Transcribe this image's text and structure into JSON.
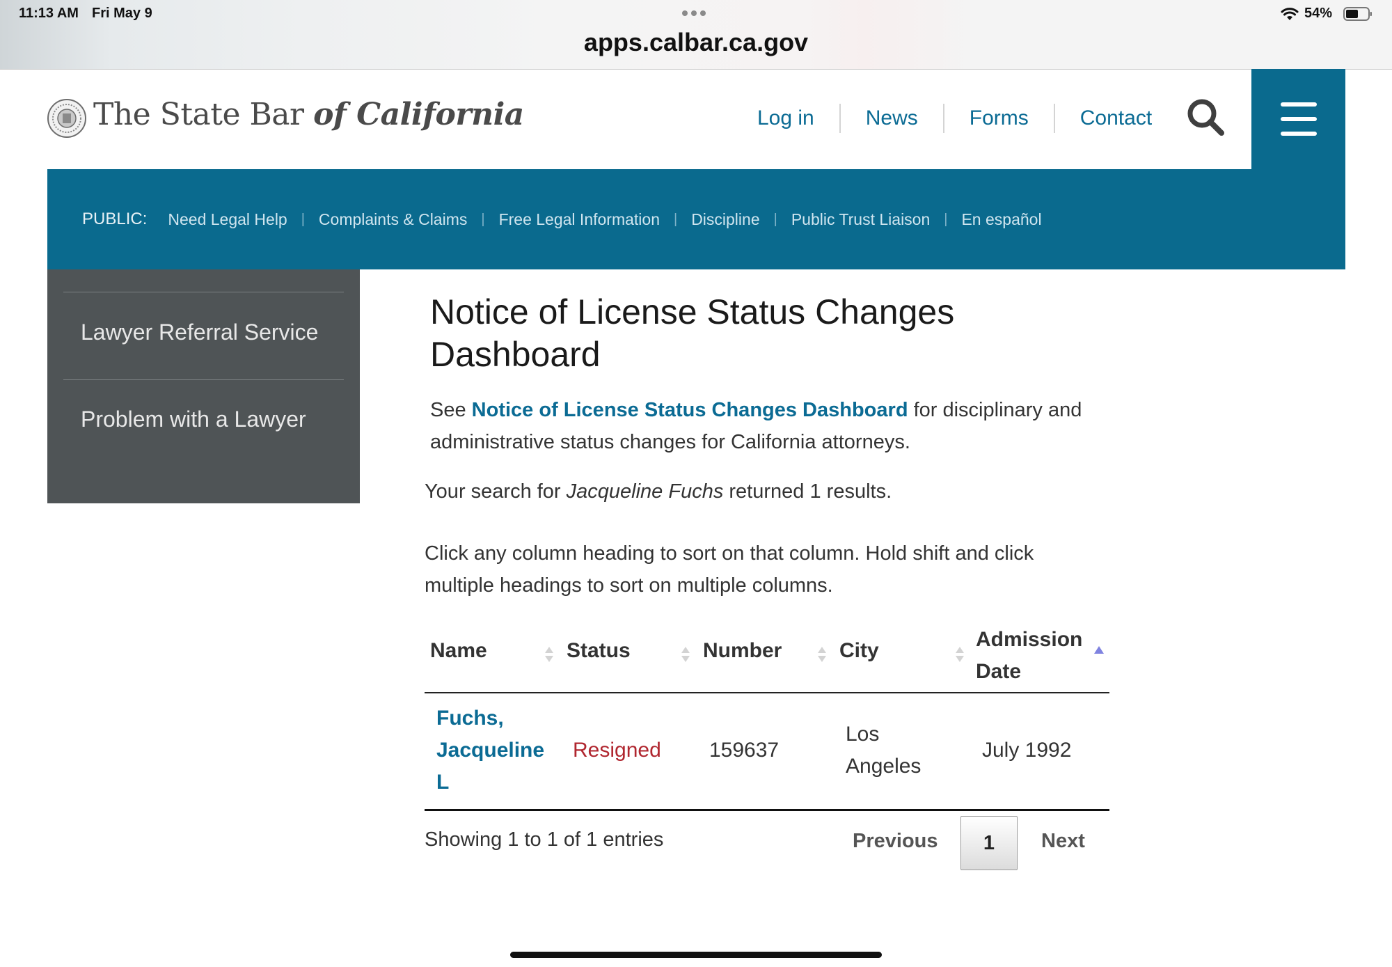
{
  "status_bar": {
    "time": "11:13 AM",
    "date": "Fri May 9",
    "url": "apps.calbar.ca.gov",
    "battery": "54%"
  },
  "header": {
    "logo": {
      "text_main": "The State Bar ",
      "text_italic": "of California"
    },
    "nav": [
      {
        "label": "Log in"
      },
      {
        "label": "News"
      },
      {
        "label": "Forms"
      },
      {
        "label": "Contact"
      }
    ],
    "search_icon": "search-icon",
    "menu_icon": "hamburger-menu-icon"
  },
  "public_bar": {
    "label": "PUBLIC:",
    "links": [
      "Need Legal Help",
      "Complaints & Claims",
      "Free Legal Information",
      "Discipline",
      "Public Trust Liaison",
      "En español"
    ]
  },
  "sidebar": {
    "items": [
      {
        "label": "Lawyer Referral Service"
      },
      {
        "label": "Problem with a Lawyer"
      }
    ]
  },
  "main": {
    "title": "Notice of License Status Changes Dashboard",
    "intro_prefix": "See ",
    "intro_link": "Notice of License Status Changes Dashboard",
    "intro_suffix": " for disciplinary and administrative status changes for California attorneys.",
    "search_prefix": "Your search for ",
    "search_query": "Jacqueline Fuchs",
    "search_suffix": " returned 1 results.",
    "sort_help": "Click any column heading to sort on that column. Hold shift and click multiple headings to sort on multiple columns."
  },
  "table": {
    "columns": [
      "Name",
      "Status",
      "Number",
      "City",
      "Admission Date"
    ],
    "sorted_column": "Admission Date",
    "rows": [
      {
        "name": "Fuchs, Jacqueline L",
        "status": "Resigned",
        "number": "159637",
        "city": "Los Angeles",
        "admission_date": "July 1992"
      }
    ],
    "footer": {
      "info": "Showing 1 to 1 of 1 entries",
      "previous": "Previous",
      "current_page": "1",
      "next": "Next"
    }
  },
  "colors": {
    "brand_blue": "#0a6a8e",
    "link_blue": "#0b6b94",
    "sidebar_gray": "#4f5456",
    "status_red": "#b0262f"
  }
}
